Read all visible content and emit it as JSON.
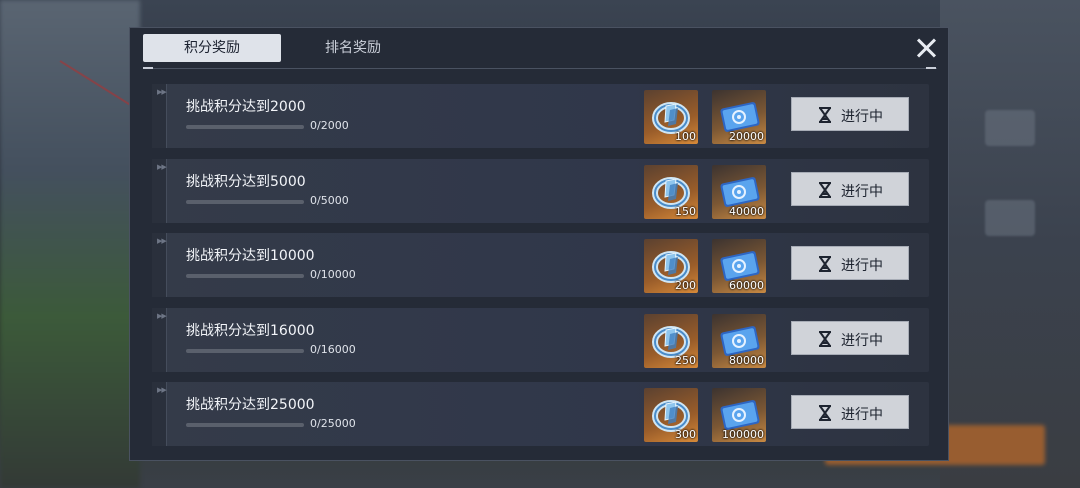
{
  "tabs": [
    {
      "label": "积分奖励",
      "active": true
    },
    {
      "label": "排名奖励",
      "active": false
    }
  ],
  "rows": [
    {
      "title": "挑战积分达到2000",
      "progress": "0/2000",
      "progress_fraction": 0,
      "reward1_qty": "100",
      "reward2_qty": "20000",
      "status": "进行中"
    },
    {
      "title": "挑战积分达到5000",
      "progress": "0/5000",
      "progress_fraction": 0,
      "reward1_qty": "150",
      "reward2_qty": "40000",
      "status": "进行中"
    },
    {
      "title": "挑战积分达到10000",
      "progress": "0/10000",
      "progress_fraction": 0,
      "reward1_qty": "200",
      "reward2_qty": "60000",
      "status": "进行中"
    },
    {
      "title": "挑战积分达到16000",
      "progress": "0/16000",
      "progress_fraction": 0,
      "reward1_qty": "250",
      "reward2_qty": "80000",
      "status": "进行中"
    },
    {
      "title": "挑战积分达到25000",
      "progress": "0/25000",
      "progress_fraction": 0,
      "reward1_qty": "300",
      "reward2_qty": "100000",
      "status": "进行中"
    }
  ],
  "icons": {
    "reward1": "crystal-ring-icon",
    "reward2": "blue-ticket-icon",
    "status": "hourglass-icon",
    "close": "close-icon"
  },
  "colors": {
    "panel": "#252b37",
    "row": "#343b49",
    "button": "#d0d3d9",
    "reward_bg": "#d78a39"
  }
}
